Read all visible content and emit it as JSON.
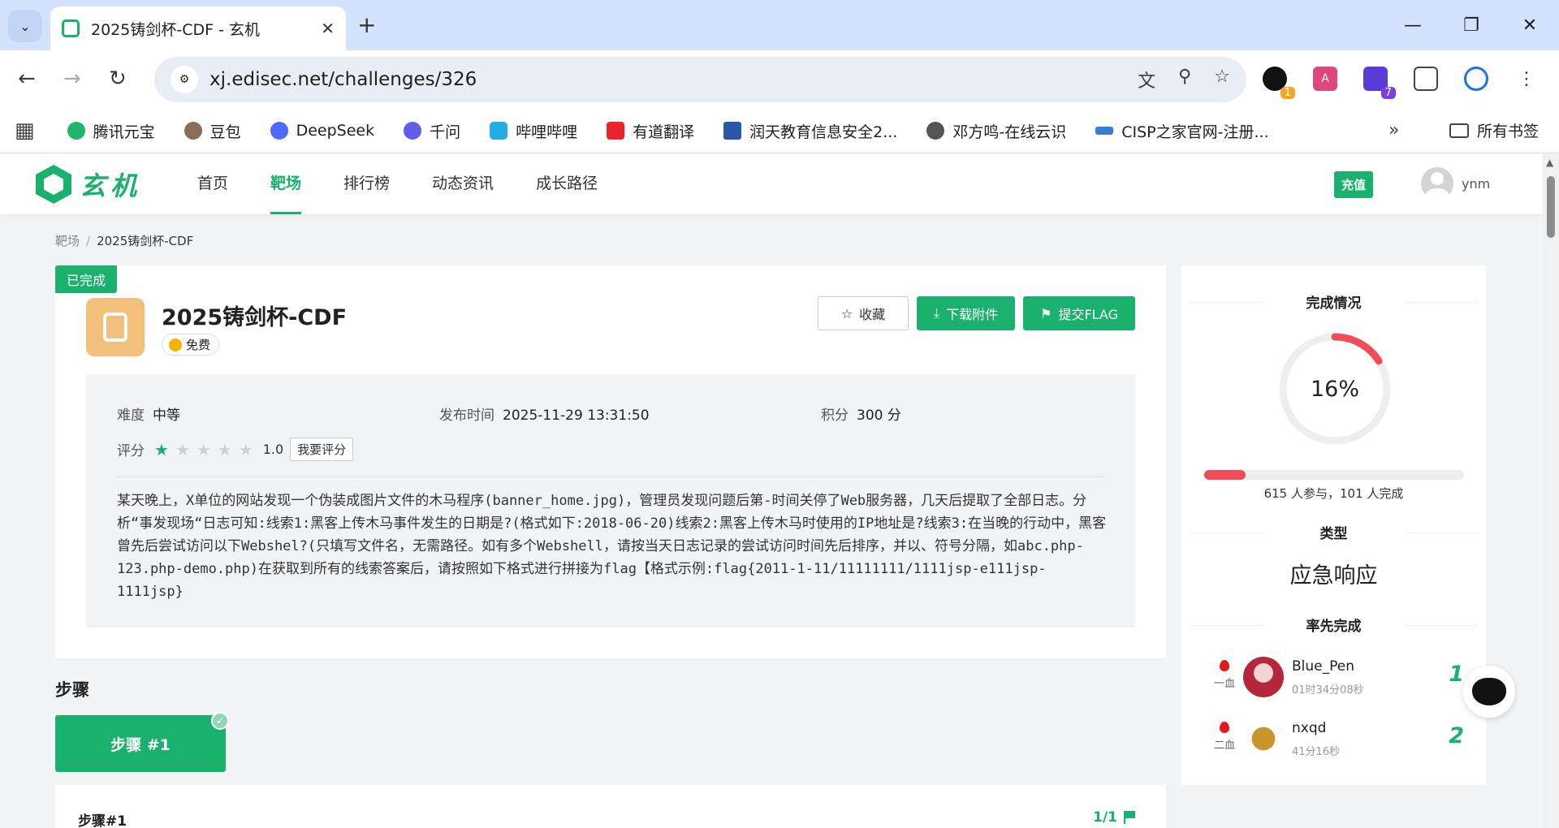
{
  "browser": {
    "tab_title": "2025铸剑杯-CDF - 玄机",
    "url": "xj.edisec.net/challenges/326",
    "bookmarks": [
      "腾讯元宝",
      "豆包",
      "DeepSeek",
      "千问",
      "哔哩哔哩",
      "有道翻译",
      "润天教育信息安全2...",
      "邓方鸣-在线云识",
      "CISP之家官网-注册..."
    ],
    "all_bookmarks": "所有书签",
    "ext_badges": [
      "1",
      "7"
    ]
  },
  "site": {
    "logo_text": "玄机",
    "nav": [
      "首页",
      "靶场",
      "排行榜",
      "动态资讯",
      "成长路径"
    ],
    "recharge": "充值",
    "username": "ynm"
  },
  "breadcrumb": {
    "parent": "靶场",
    "sep": "/",
    "current": "2025铸剑杯-CDF"
  },
  "challenge": {
    "status": "已完成",
    "title": "2025铸剑杯-CDF",
    "price": "免费",
    "buttons": {
      "favorite": "收藏",
      "download": "下载附件",
      "submit": "提交FLAG"
    },
    "difficulty_label": "难度",
    "difficulty": "中等",
    "publish_label": "发布时间",
    "publish_time": "2025-11-29 13:31:50",
    "score_label": "积分",
    "score": "300 分",
    "rating_label": "评分",
    "rating_stars": 1,
    "rating_value": "1.0",
    "rate_button": "我要评分",
    "description": "某天晚上，X单位的网站发现一个伪装成图片文件的木马程序(banner_home.jpg)，管理员发现问题后第-时间关停了Web服务器，几天后提取了全部日志。分析“事发现场“日志可知:线索1:黑客上传木马事件发生的日期是?(格式如下:2018-06-20)线索2:黑客上传木马时使用的IP地址是?线索3:在当晚的行动中，黑客曾先后尝试访问以下Webshel?(只填写文件名，无需路径。如有多个Webshell，请按当天日志记录的尝试访问时间先后排序，并以、符号分隔，如abc.php-123.php-demo.php)在获取到所有的线索答案后，请按照如下格式进行拼接为flag【格式示例:flag{2011-1-11/11111111/1111jsp-e111jsp-1111jsp}"
  },
  "steps": {
    "title": "步骤",
    "tab_label": "步骤 #1",
    "card_title": "步骤#1",
    "progress": "1/1"
  },
  "sidebar": {
    "completion_title": "完成情况",
    "completion_percent": "16%",
    "completion_fraction": 0.16,
    "participants": "615 人参与，101 人完成",
    "type_title": "类型",
    "type_value": "应急响应",
    "first_title": "率先完成",
    "solvers": [
      {
        "blood": "一血",
        "name": "Blue_Pen",
        "time": "01时34分08秒",
        "rank": "1"
      },
      {
        "blood": "二血",
        "name": "nxqd",
        "time": "41分16秒",
        "rank": "2"
      }
    ]
  },
  "colors": {
    "accent": "#1ab06e",
    "progress": "#f24b5a",
    "rating_on": "#1ab06e"
  }
}
